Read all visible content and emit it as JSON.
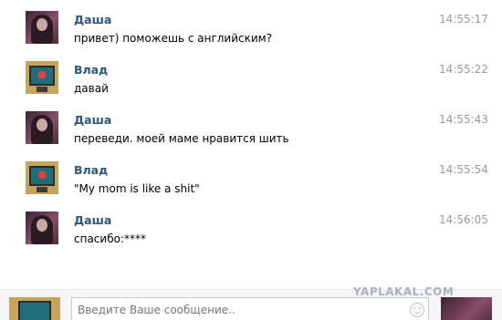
{
  "messages": [
    {
      "author": "Даша",
      "text": "привет) поможешь с английским?",
      "time": "14:55:17"
    },
    {
      "author": "Влад",
      "text": "давай",
      "time": "14:55:22"
    },
    {
      "author": "Даша",
      "text": "переведи. моей маме нравится шить",
      "time": "14:55:43"
    },
    {
      "author": "Влад",
      "text": "\"My mom is like a shit\"",
      "time": "14:55:54"
    },
    {
      "author": "Даша",
      "text": "спасибо:****",
      "time": "14:56:05"
    }
  ],
  "composer": {
    "placeholder": "Введите Ваше сообщение.."
  },
  "watermark": "YAPLAKAL.COM",
  "colors": {
    "author_name": "#2b587a",
    "timestamp": "#999999",
    "input_border": "#c3cbd4"
  },
  "icons": {
    "emoji_button": "smile-icon"
  }
}
